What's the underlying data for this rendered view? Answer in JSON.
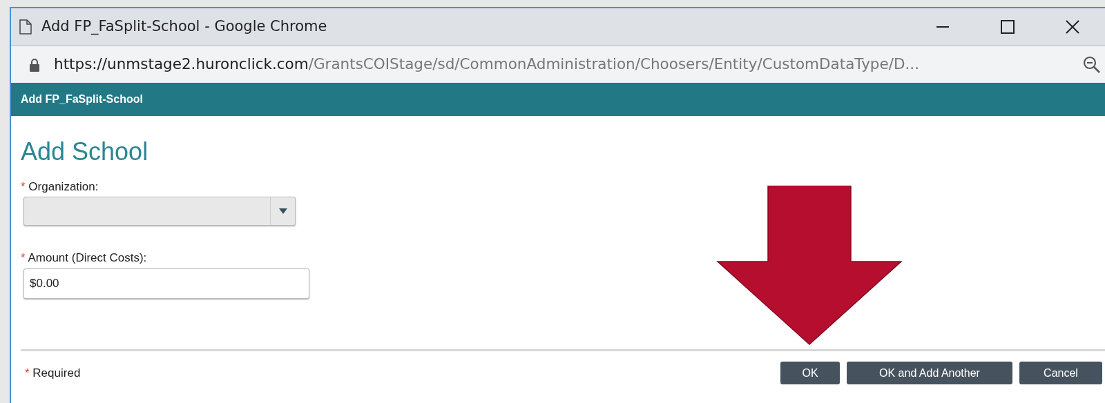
{
  "window": {
    "title": "Add FP_FaSplit-School - Google Chrome"
  },
  "address_bar": {
    "host": "https://unmstage2.huronclick.com",
    "path": "/GrantsCOIStage/sd/CommonAdministration/Choosers/Entity/CustomDataType/D..."
  },
  "dialog": {
    "header": "Add FP_FaSplit-School",
    "heading": "Add School"
  },
  "fields": [
    {
      "kind": "select",
      "label": "Organization:",
      "required": true
    },
    {
      "kind": "text",
      "label": "Amount (Direct Costs):",
      "required": true,
      "value": "$0.00"
    }
  ],
  "footer": {
    "required_note": "Required",
    "required_mark": "*"
  },
  "buttons": [
    "OK",
    "OK and Add Another",
    "Cancel"
  ]
}
